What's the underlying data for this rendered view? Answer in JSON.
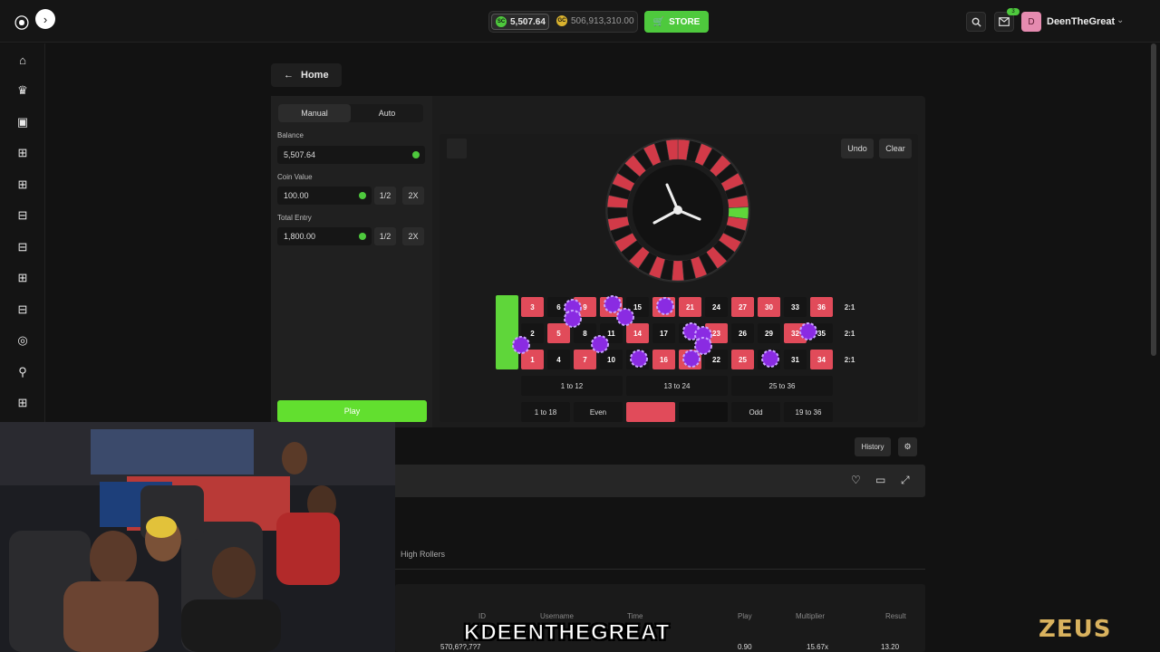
{
  "topbar": {
    "sc_balance": "5,507.64",
    "sc_label": "SC",
    "gc_balance": "506,913,310.00",
    "gc_label": "GC",
    "store_label": "STORE",
    "notif_count": "3",
    "avatar_initial": "D",
    "username": "DeenTheGreat"
  },
  "sidebar": {
    "icons": [
      "home-icon",
      "crown-icon",
      "gift-box-icon",
      "gift-icon",
      "gift-icon",
      "ticket-icon",
      "ticket-icon",
      "gift-icon",
      "ticket-icon",
      "support-icon",
      "user-add-icon",
      "gift-icon"
    ]
  },
  "nav": {
    "home_label": "Home"
  },
  "controls": {
    "tabs": [
      "Manual",
      "Auto"
    ],
    "balance_label": "Balance",
    "balance_value": "5,507.64",
    "coin_value_label": "Coin Value",
    "coin_value": "100.00",
    "total_entry_label": "Total Entry",
    "total_entry": "1,800.00",
    "half_label": "1/2",
    "double_label": "2X",
    "play_label": "Play"
  },
  "board": {
    "undo_label": "Undo",
    "clear_label": "Clear",
    "zero_label": "0",
    "rows": [
      [
        {
          "n": "3",
          "c": "red"
        },
        {
          "n": "6",
          "c": "black"
        },
        {
          "n": "9",
          "c": "red"
        },
        {
          "n": "12",
          "c": "red"
        },
        {
          "n": "15",
          "c": "black"
        },
        {
          "n": "18",
          "c": "red"
        },
        {
          "n": "21",
          "c": "red"
        },
        {
          "n": "24",
          "c": "black"
        },
        {
          "n": "27",
          "c": "red"
        },
        {
          "n": "30",
          "c": "red"
        },
        {
          "n": "33",
          "c": "black"
        },
        {
          "n": "36",
          "c": "red"
        }
      ],
      [
        {
          "n": "2",
          "c": "black"
        },
        {
          "n": "5",
          "c": "red"
        },
        {
          "n": "8",
          "c": "black"
        },
        {
          "n": "11",
          "c": "black"
        },
        {
          "n": "14",
          "c": "red"
        },
        {
          "n": "17",
          "c": "black"
        },
        {
          "n": "20",
          "c": "black"
        },
        {
          "n": "23",
          "c": "red"
        },
        {
          "n": "26",
          "c": "black"
        },
        {
          "n": "29",
          "c": "black"
        },
        {
          "n": "32",
          "c": "red"
        },
        {
          "n": "35",
          "c": "black"
        }
      ],
      [
        {
          "n": "1",
          "c": "red"
        },
        {
          "n": "4",
          "c": "black"
        },
        {
          "n": "7",
          "c": "red"
        },
        {
          "n": "10",
          "c": "black"
        },
        {
          "n": "13",
          "c": "black"
        },
        {
          "n": "16",
          "c": "red"
        },
        {
          "n": "19",
          "c": "red"
        },
        {
          "n": "22",
          "c": "black"
        },
        {
          "n": "25",
          "c": "red"
        },
        {
          "n": "28",
          "c": "black"
        },
        {
          "n": "31",
          "c": "black"
        },
        {
          "n": "34",
          "c": "red"
        }
      ]
    ],
    "column_label": "2:1",
    "dozens": [
      "1 to 12",
      "13 to 24",
      "25 to 36"
    ],
    "outside": [
      "1 to 18",
      "Even",
      "",
      "",
      "Odd",
      "19 to 36"
    ]
  },
  "footer": {
    "history_label": "History"
  },
  "high_rollers": {
    "title": "High Rollers",
    "columns": [
      "ID",
      "Username",
      "Time",
      "Play",
      "Multiplier",
      "Result"
    ],
    "row": [
      "570,6??,7?7",
      "??",
      "??:??",
      "0.90",
      "15.67x",
      "13.20"
    ]
  },
  "overlay": {
    "caption": "KDEENTHEGREAT",
    "watermark": "ZEUS"
  },
  "colors": {
    "accent_green": "#4ec93d",
    "red": "#e14b5a",
    "chip": "#8a2be2"
  }
}
